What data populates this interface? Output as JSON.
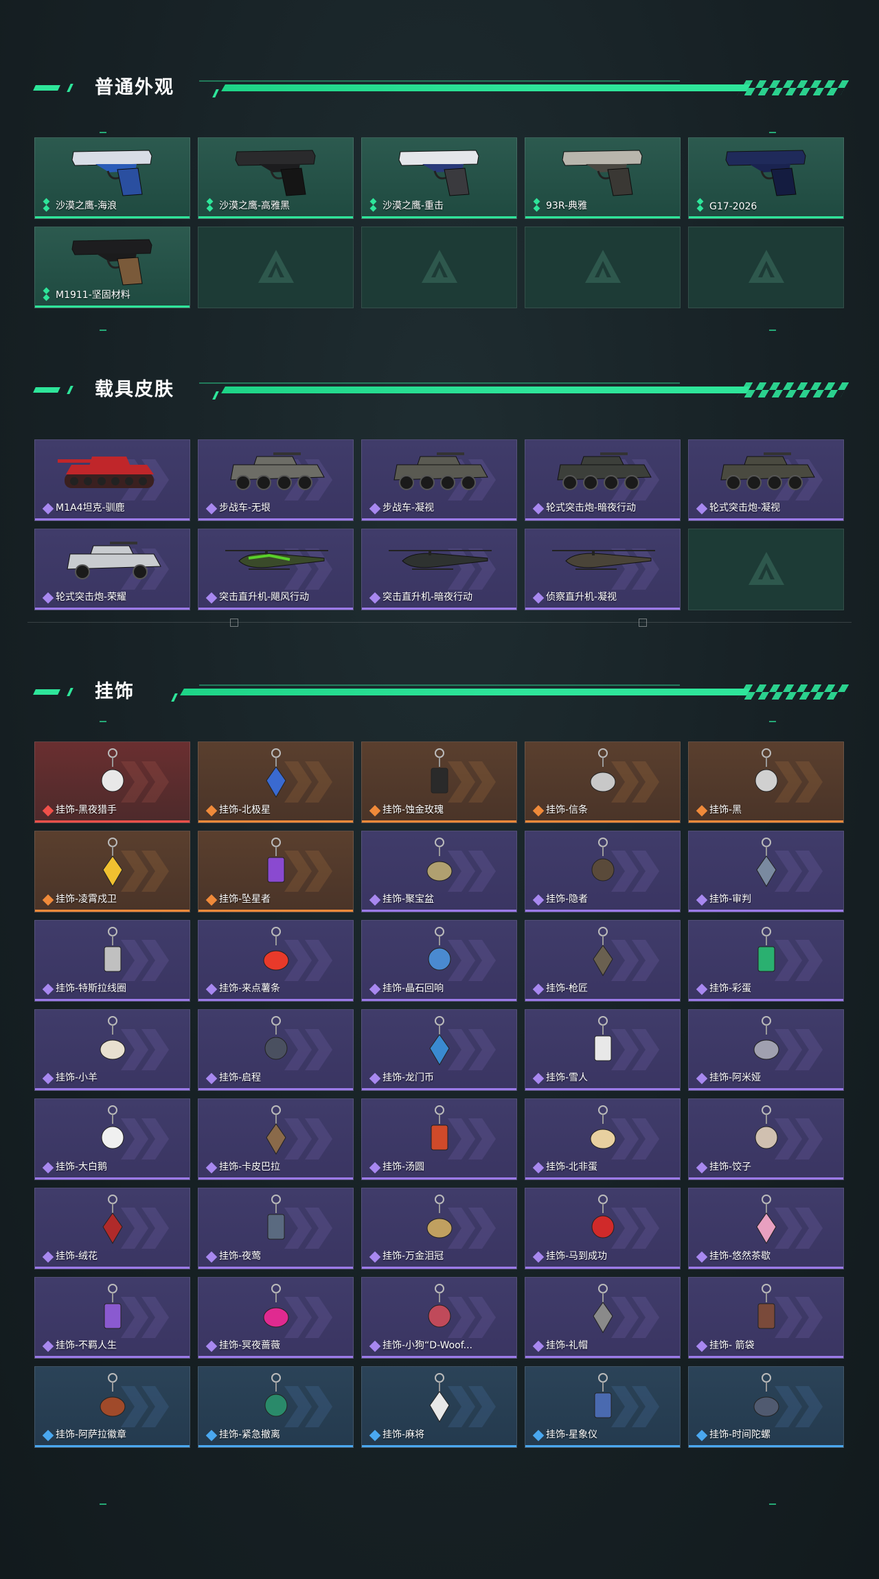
{
  "sections": {
    "weapon": {
      "title": "普通外观",
      "items": [
        {
          "label": "沙漠之鹰-海浪"
        },
        {
          "label": "沙漠之鹰-高雅黑"
        },
        {
          "label": "沙漠之鹰-重击"
        },
        {
          "label": "93R-典雅"
        },
        {
          "label": "G17-2026"
        },
        {
          "label": "M1911-坚固材料"
        }
      ],
      "empty_slots": 4
    },
    "vehicle": {
      "title": "载具皮肤",
      "items": [
        {
          "label": "M1A4坦克-驯鹿"
        },
        {
          "label": "步战车-无垠"
        },
        {
          "label": "步战车-凝视"
        },
        {
          "label": "轮式突击炮-暗夜行动"
        },
        {
          "label": "轮式突击炮-凝视"
        },
        {
          "label": "轮式突击炮-荣耀"
        },
        {
          "label": "突击直升机-飓风行动"
        },
        {
          "label": "突击直升机-暗夜行动"
        },
        {
          "label": "侦察直升机-凝视"
        }
      ],
      "empty_slots": 1
    },
    "charm": {
      "title": "挂饰",
      "items": [
        {
          "label": "挂饰-黑夜猎手",
          "rarity": "red"
        },
        {
          "label": "挂饰-北极星",
          "rarity": "orange"
        },
        {
          "label": "挂饰-蚀金玫瑰",
          "rarity": "orange"
        },
        {
          "label": "挂饰-信条",
          "rarity": "orange"
        },
        {
          "label": "挂饰-黑",
          "rarity": "orange"
        },
        {
          "label": "挂饰-凌霄戍卫",
          "rarity": "orange"
        },
        {
          "label": "挂饰-坠星者",
          "rarity": "orange"
        },
        {
          "label": "挂饰-聚宝盆",
          "rarity": "purple"
        },
        {
          "label": "挂饰-隐者",
          "rarity": "purple"
        },
        {
          "label": "挂饰-审判",
          "rarity": "purple"
        },
        {
          "label": "挂饰-特斯拉线圈",
          "rarity": "purple"
        },
        {
          "label": "挂饰-来点薯条",
          "rarity": "purple"
        },
        {
          "label": "挂饰-晶石回响",
          "rarity": "purple"
        },
        {
          "label": "挂饰-枪匠",
          "rarity": "purple"
        },
        {
          "label": "挂饰-彩蛋",
          "rarity": "purple"
        },
        {
          "label": "挂饰-小羊",
          "rarity": "purple"
        },
        {
          "label": "挂饰-启程",
          "rarity": "purple"
        },
        {
          "label": "挂饰-龙门币",
          "rarity": "purple"
        },
        {
          "label": "挂饰-雪人",
          "rarity": "purple"
        },
        {
          "label": "挂饰-阿米娅",
          "rarity": "purple"
        },
        {
          "label": "挂饰-大白鹅",
          "rarity": "purple"
        },
        {
          "label": "挂饰-卡皮巴拉",
          "rarity": "purple"
        },
        {
          "label": "挂饰-汤圆",
          "rarity": "purple"
        },
        {
          "label": "挂饰-北非蛋",
          "rarity": "purple"
        },
        {
          "label": "挂饰-饺子",
          "rarity": "purple"
        },
        {
          "label": "挂饰-绒花",
          "rarity": "purple"
        },
        {
          "label": "挂饰-夜莺",
          "rarity": "purple"
        },
        {
          "label": "挂饰-万金泪冠",
          "rarity": "purple"
        },
        {
          "label": "挂饰-马到成功",
          "rarity": "purple"
        },
        {
          "label": "挂饰-悠然茶歇",
          "rarity": "purple"
        },
        {
          "label": "挂饰-不羁人生",
          "rarity": "purple"
        },
        {
          "label": "挂饰-冥夜蔷薇",
          "rarity": "purple"
        },
        {
          "label": "挂饰-小狗“D-Woof...",
          "rarity": "purple"
        },
        {
          "label": "挂饰-礼帽",
          "rarity": "purple"
        },
        {
          "label": "挂饰- 箭袋",
          "rarity": "purple"
        },
        {
          "label": "挂饰-阿萨拉徽章",
          "rarity": "blue"
        },
        {
          "label": "挂饰-紧急撤离",
          "rarity": "blue"
        },
        {
          "label": "挂饰-麻将",
          "rarity": "blue"
        },
        {
          "label": "挂饰-星象仪",
          "rarity": "blue"
        },
        {
          "label": "挂饰-时间陀螺",
          "rarity": "blue"
        }
      ]
    }
  },
  "colors": {
    "accent": "#2ee59a",
    "rarity_red": "#f0504a",
    "rarity_orange": "#f08a3a",
    "rarity_purple": "#9b7ae8",
    "rarity_blue": "#4aa8f0",
    "rarity_green": "#2ee59a"
  },
  "icons": {
    "weapon_rarity": "green-stacked-diamonds-icon",
    "item_rarity": "four-diamond-cluster-icon",
    "empty_slot": "brand-triangle-logo-icon",
    "section_bar": "green-stripe-checker-bar"
  }
}
